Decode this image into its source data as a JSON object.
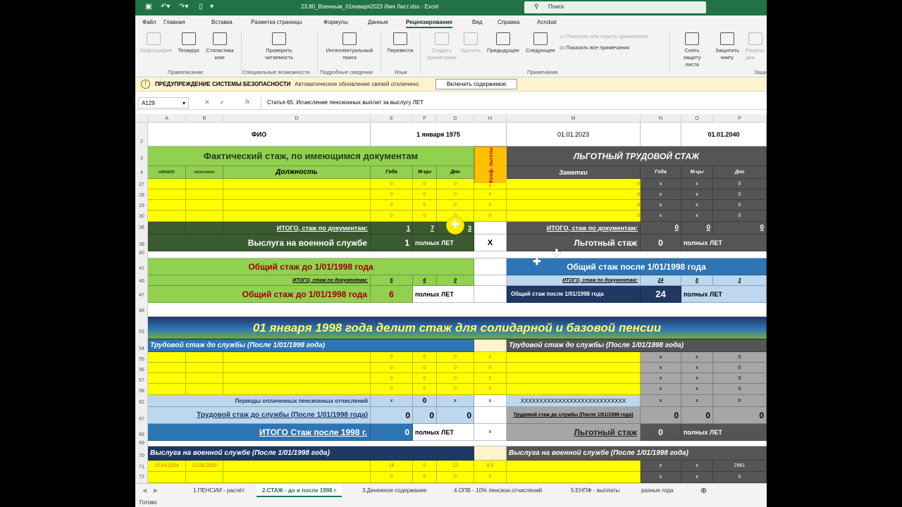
{
  "titlebar": {
    "filename": "23.80_Военным_01января2023 Имя Лист.xlsx  -  Excel",
    "search": "Поиск"
  },
  "tabs": [
    "Файл",
    "Главная",
    "Вставка",
    "Разметка страницы",
    "Формулы",
    "Данные",
    "Рецензирование",
    "Вид",
    "Справка",
    "Acrobat"
  ],
  "ribbon": {
    "spelling": "Орфография",
    "thesaurus": "Тезаурус",
    "stats": "Статистика книг",
    "check_access": "Проверить читаемость",
    "smart_search": "Интеллектуальный поиск",
    "translate": "Перевести",
    "new_comment": "Создать примечание",
    "delete": "Удалить",
    "prev": "Предыдущее",
    "next": "Следующее",
    "show_hide": "Показать или скрыть примечание",
    "show_all": "Показать все примечания",
    "protect_sheet": "Снять защиту листа",
    "protect_book": "Защитить книгу",
    "allow": "Разреш диа",
    "g_spelling": "Правописание",
    "g_access": "Специальные возможности",
    "g_insights": "Подробные сведения",
    "g_lang": "Язык",
    "g_comments": "Примечания",
    "g_protect": "Защи"
  },
  "warning": {
    "title": "ПРЕДУПРЕЖДЕНИЕ СИСТЕМЫ БЕЗОПАСНОСТИ",
    "message": "Автоматическое обновление связей отключено",
    "button": "Включить содержимое"
  },
  "formula": {
    "namebox": "A129",
    "fx": "fx",
    "content": "Статья 65. Исчисление пенсионных выплат за выслугу ЛЕТ"
  },
  "columns": [
    "A",
    "B",
    "D",
    "E",
    "F",
    "G",
    "H",
    "M",
    "N",
    "O",
    "P"
  ],
  "rows": [
    "2",
    "3",
    "4",
    "27",
    "28",
    "29",
    "30",
    "38",
    "39",
    "40",
    "41",
    "46",
    "47",
    "48",
    "53",
    "54",
    "55",
    "56",
    "57",
    "58",
    "62",
    "67",
    "68",
    "69",
    "70",
    "71",
    "72"
  ],
  "sheet": {
    "fio": "ФИО",
    "date1975": "1 января 1975",
    "date2023": "01.01.2023",
    "date2040": "01.01.2040",
    "fact_title": "Фактический стаж, по имеющимся документам",
    "coef": "Коэф. льготы",
    "lgot_title": "ЛЬГОТНЫЙ ТРУДОВОЙ СТАЖ",
    "h_start": "начало",
    "h_end": "окончание",
    "h_pos": "Должность",
    "h_years": "Года",
    "h_months": "М-цы",
    "h_days": "Дни",
    "h_notes": "Заметки",
    "zero": "0",
    "x": "x",
    "X": "X",
    "itogo_docs": "ИТОГО, стаж по документам:",
    "itogo_y": "1",
    "itogo_m": "7",
    "itogo_d": "3",
    "mil": "Выслуга на военной службе",
    "mil_y": "1",
    "full_years": "полных ЛЕТ",
    "lgot_stazh": "Льготный стаж",
    "obsh_do": "Общий стаж до 1/01/1998 года",
    "obsh_posle": "Общий стаж после 1/01/1998 года",
    "itogo_small": "ИТОГО, стаж по документам:",
    "do_y": "6",
    "do_m": "6",
    "do_d": "0",
    "posle_y": "24",
    "posle_m": "8",
    "posle_d": "3",
    "obsh_do_val": "6",
    "obsh_posle_small": "Общий стаж после 1/01/1998 года",
    "posle_val": "24",
    "banner": "01 января 1998 года делит стаж для солидарной и базовой пенсии",
    "trud_do": "Трудовой стаж до службы (После 1/01/1998 года)",
    "periods": "Периоды оплаченных пенсионных отчислений",
    "xxx": "XXXXXXXXXXXXXXXXXXXXXXXXXXXX",
    "itogo_1998": "ИТОГО Стаж после 1998 г.",
    "mil_after": "Выслуга на военной службе (После 1/01/1998 года)",
    "r71_start": "10.04.2004",
    "r71_end": "22.09.2020",
    "r71_y": "16",
    "r71_m": "5",
    "r71_d": "12",
    "r71_coef": "0,5",
    "r71_p": "2961"
  },
  "sheettabs": [
    "1.ПЕНСИИ - расчёт",
    "2.СТАЖ - до и после 1998 г",
    "3.Денежное содержание",
    "4.ОПВ - 10% пенсион.отчислений",
    "5.ЕНПФ - выплаты",
    "разные года"
  ],
  "status": "Готово"
}
